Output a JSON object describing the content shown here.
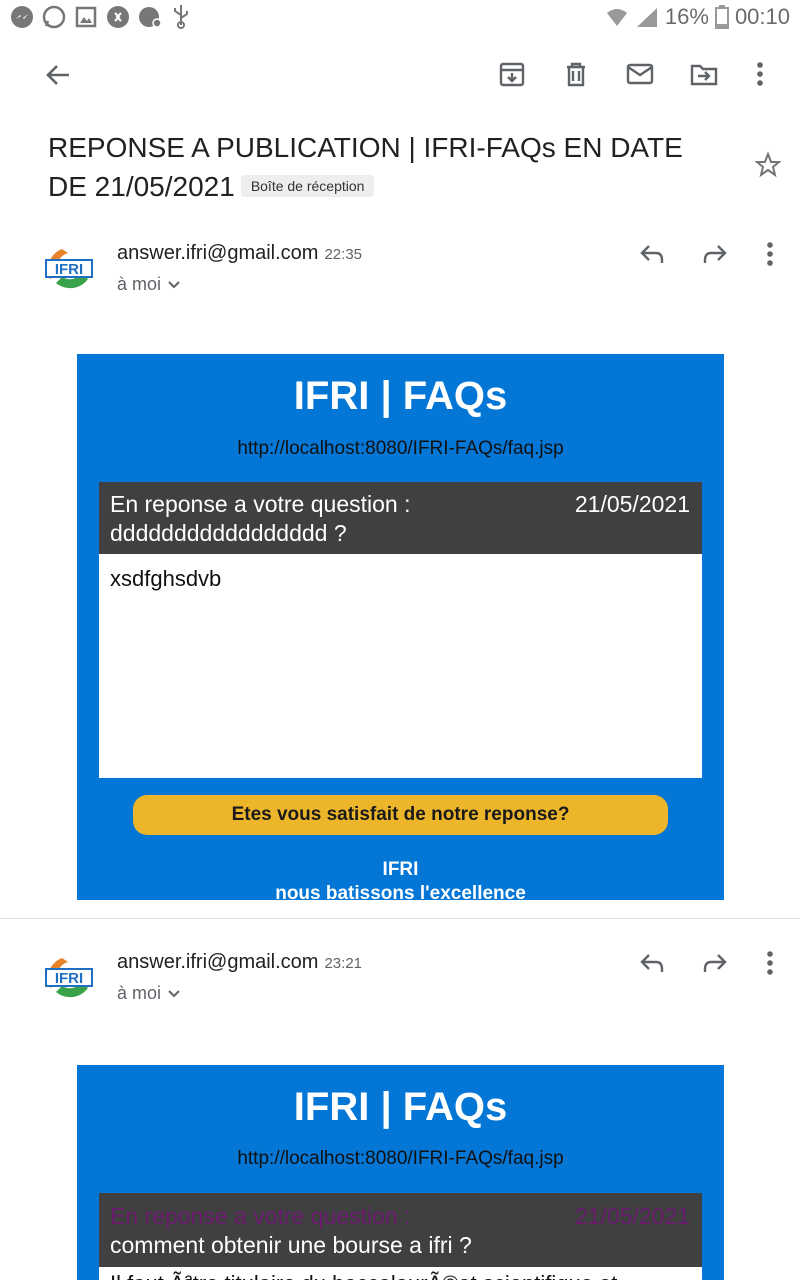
{
  "status_bar": {
    "battery": "16%",
    "time": "00:10",
    "left_icons": [
      "messenger-icon",
      "whatsapp-icon",
      "gallery-icon",
      "shazam-icon",
      "app-icon",
      "usb-icon"
    ]
  },
  "toolbar": {
    "back": "arrow-back-icon",
    "actions": [
      "archive-icon",
      "delete-icon",
      "mark-unread-icon",
      "move-to-icon",
      "more-vert-icon"
    ]
  },
  "subject": {
    "title": "REPONSE A  PUBLICATION | IFRI-FAQs EN DATE DE 21/05/2021",
    "label": "Boîte de réception"
  },
  "messages": [
    {
      "sender": "answer.ifri@gmail.com",
      "time": "22:35",
      "recipient": "à moi",
      "body": {
        "brand": "IFRI | FAQs",
        "url": "http://localhost:8080/IFRI-FAQs/faq.jsp",
        "question_label": "En reponse a votre question :",
        "question": "ddddddddddddddddd ?",
        "date": "21/05/2021",
        "answer": "xsdfghsdvb",
        "cta": "Etes vous satisfait de notre reponse?",
        "footer_line1": "IFRI",
        "footer_line2": "nous batissons l'excellence"
      }
    },
    {
      "sender": "answer.ifri@gmail.com",
      "time": "23:21",
      "recipient": "à moi",
      "body": {
        "brand": "IFRI | FAQs",
        "url": "http://localhost:8080/IFRI-FAQs/faq.jsp",
        "question_label": "En reponse a votre question :",
        "question": "comment obtenir une bourse a ifri ?",
        "date": "21/05/2021",
        "answer": "Il faut Ãªtre titulaire du baccalaurÃ©at scientifique et"
      }
    }
  ],
  "colors": {
    "card_blue": "#0376d6",
    "header_gray": "#404040",
    "cta_yellow": "#ecb52a",
    "visited_purple": "#6a1b6e"
  }
}
